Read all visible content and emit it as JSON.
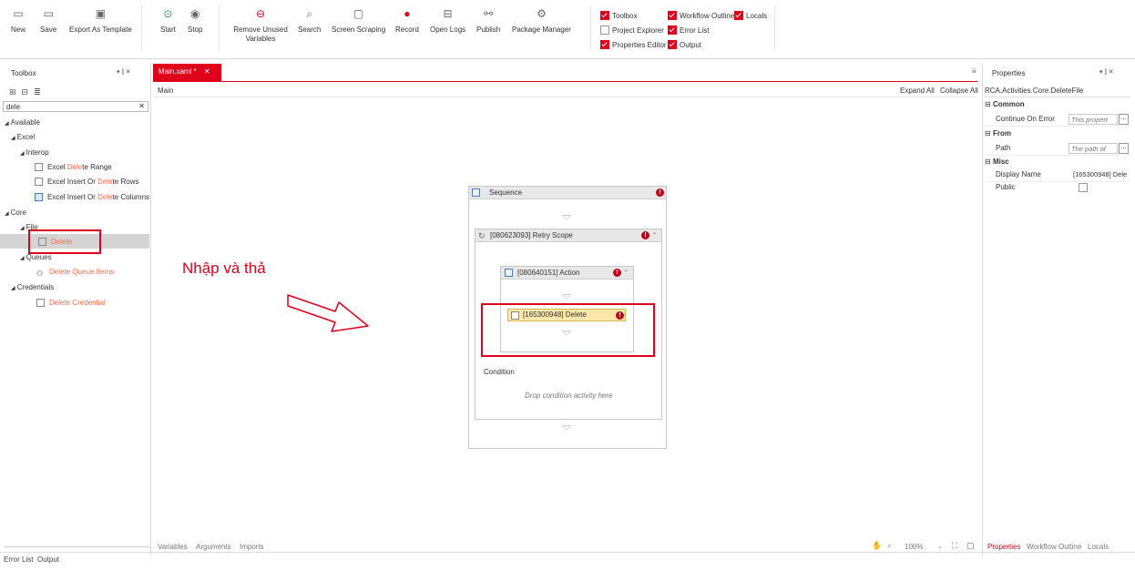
{
  "ribbon": {
    "buttons": [
      {
        "label": "New",
        "icon": "new-file-icon"
      },
      {
        "label": "Save",
        "icon": "save-icon"
      },
      {
        "label": "Export As Template",
        "icon": "export-template-icon"
      },
      {
        "label": "Start",
        "icon": "start-play-icon"
      },
      {
        "label": "Stop",
        "icon": "stop-icon"
      },
      {
        "label": "Remove Unused\nVariables",
        "icon": "remove-variables-icon"
      },
      {
        "label": "Search",
        "icon": "search-icon"
      },
      {
        "label": "Screen Scraping",
        "icon": "screen-scraping-icon"
      },
      {
        "label": "Record",
        "icon": "record-icon"
      },
      {
        "label": "Open Logs",
        "icon": "open-logs-icon"
      },
      {
        "label": "Publish",
        "icon": "publish-icon"
      },
      {
        "label": "Package Manager",
        "icon": "package-manager-icon"
      }
    ],
    "panels": [
      {
        "label": "Toolbox",
        "checked": true
      },
      {
        "label": "Workflow Outline",
        "checked": true
      },
      {
        "label": "Locals",
        "checked": true
      },
      {
        "label": "Project Explorer",
        "checked": false
      },
      {
        "label": "Error List",
        "checked": true
      },
      {
        "label": "Properties Editor",
        "checked": true
      },
      {
        "label": "Output",
        "checked": true
      }
    ]
  },
  "toolbox": {
    "title": "Toolbox",
    "search_value": "dele",
    "tree": {
      "available": "Available",
      "excel": "Excel",
      "interop": "Interop",
      "items_excel": [
        {
          "pre": "Excel ",
          "hl": "Dele",
          "post": "te Range"
        },
        {
          "pre": "Excel Insert Or ",
          "hl": "Dele",
          "post": "te Rows"
        },
        {
          "pre": "Excel Insert Or ",
          "hl": "Dele",
          "post": "te Columns"
        }
      ],
      "core": "Core",
      "file": "File",
      "delete_hl": "Dele",
      "delete_post": "te",
      "queues": "Queues",
      "queue_item": {
        "hl": "Dele",
        "post": "te Queue Items"
      },
      "credentials": "Credentials",
      "credential_item": {
        "hl": "Dele",
        "post": "te Credential"
      }
    }
  },
  "designer": {
    "tab_label": "Main.xaml *",
    "breadcrumb": "Main",
    "expand_all": "Expand All",
    "collapse_all": "Collapse All",
    "sequence_title": "Sequence",
    "retry_title": "[080623093] Retry Scope",
    "action_title": "[080640151] Action",
    "delete_title": "[165300948] Delete",
    "condition_label": "Condition",
    "condition_placeholder": "Drop condition activity here",
    "annotation": "Nhập và thả",
    "bottom_tabs": [
      "Variables",
      "Arguments",
      "Imports"
    ],
    "zoom": "100%"
  },
  "properties": {
    "title": "Properties",
    "type_name": "RCA.Activities.Core.DeleteFile",
    "categories": {
      "common": "Common",
      "from": "From",
      "misc": "Misc"
    },
    "rows": {
      "continue_on_error": {
        "name": "Continue On Error",
        "value": "This propert"
      },
      "path": {
        "name": "Path",
        "value": "The path of"
      },
      "display_name": {
        "name": "Display Name",
        "value": "[165300948] Dele"
      },
      "public": {
        "name": "Public"
      }
    },
    "bottom_tabs": [
      "Properties",
      "Workflow Outline",
      "Locals"
    ]
  },
  "footer": {
    "tabs": [
      "Error List",
      "Output"
    ]
  },
  "colors": {
    "accent": "#e0001b",
    "highlight": "#ff6b4a",
    "error": "#c5001a",
    "delete_activity_bg": "#fbe7a8"
  }
}
